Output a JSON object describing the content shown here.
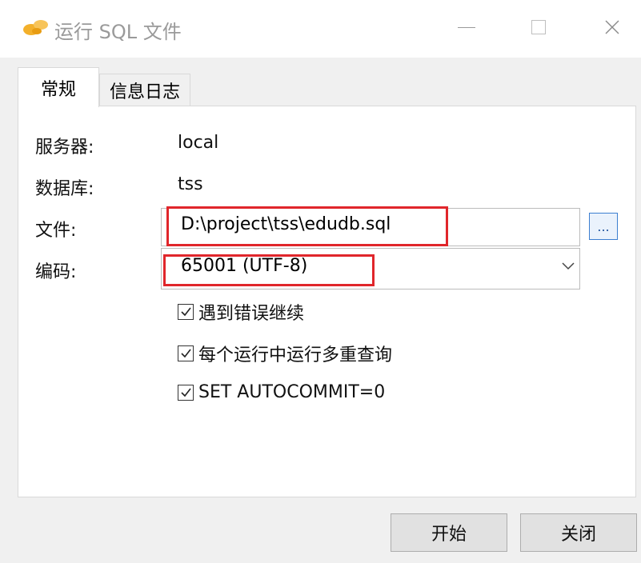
{
  "window": {
    "title": "运行 SQL 文件"
  },
  "tabs": [
    {
      "label": "常规",
      "active": true
    },
    {
      "label": "信息日志",
      "active": false
    }
  ],
  "form": {
    "server_label": "服务器:",
    "server_value": "local",
    "database_label": "数据库:",
    "database_value": "tss",
    "file_label": "文件:",
    "file_value": "D:\\project\\tss\\edudb.sql",
    "browse_label": "...",
    "encoding_label": "编码:",
    "encoding_value": "65001 (UTF-8)"
  },
  "options": [
    {
      "label": "遇到错误继续",
      "checked": true
    },
    {
      "label": "每个运行中运行多重查询",
      "checked": true
    },
    {
      "label": "SET AUTOCOMMIT=0",
      "checked": true
    }
  ],
  "buttons": {
    "start": "开始",
    "close": "关闭"
  },
  "colors": {
    "highlight": "#e0262b",
    "app_icon": "#f3b02b",
    "browse_border": "#3c7fd0"
  }
}
